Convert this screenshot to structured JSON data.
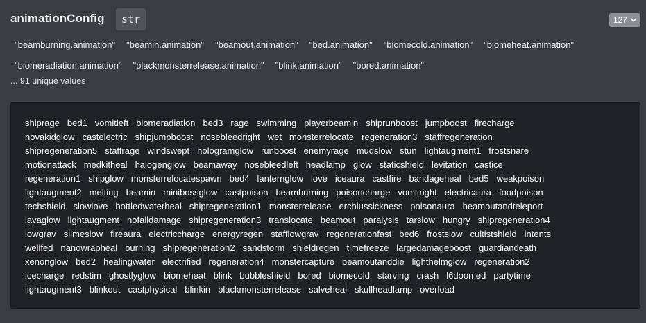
{
  "field": {
    "name": "animationConfig",
    "type": "str",
    "count_label": "127"
  },
  "preview_tags": [
    [
      "\"beamburning.animation\"",
      "\"beamin.animation\"",
      "\"beamout.animation\"",
      "\"bed.animation\"",
      "\"biomecold.animation\"",
      "\"biomeheat.animation\""
    ],
    [
      "\"biomeradiation.animation\"",
      "\"blackmonsterrelease.animation\"",
      "\"blink.animation\"",
      "\"bored.animation\""
    ]
  ],
  "unique_note": "... 91 unique values",
  "values": [
    [
      "shiprage",
      "bed1",
      "vomitleft",
      "biomeradiation",
      "bed3",
      "rage",
      "swimming",
      "playerbeamin",
      "shiprunboost",
      "jumpboost",
      "firecharge"
    ],
    [
      "novakidglow",
      "castelectric",
      "shipjumpboost",
      "nosebleedright",
      "wet",
      "monsterrelocate",
      "regeneration3",
      "staffregeneration"
    ],
    [
      "shipregeneration5",
      "staffrage",
      "windswept",
      "hologramglow",
      "runboost",
      "enemyrage",
      "mudslow",
      "stun",
      "lightaugment1",
      "frostsnare"
    ],
    [
      "motionattack",
      "medkitheal",
      "halogenglow",
      "beamaway",
      "nosebleedleft",
      "headlamp",
      "glow",
      "staticshield",
      "levitation",
      "castice"
    ],
    [
      "regeneration1",
      "shipglow",
      "monsterrelocatespawn",
      "bed4",
      "lanternglow",
      "love",
      "iceaura",
      "castfire",
      "bandageheal",
      "bed5",
      "weakpoison"
    ],
    [
      "lightaugment2",
      "melting",
      "beamin",
      "minibossglow",
      "castpoison",
      "beamburning",
      "poisoncharge",
      "vomitright",
      "electricaura",
      "foodpoison"
    ],
    [
      "techshield",
      "slowlove",
      "bottledwaterheal",
      "shipregeneration1",
      "monsterrelease",
      "erchiussickness",
      "poisonaura",
      "beamoutandteleport"
    ],
    [
      "lavaglow",
      "lightaugment",
      "nofalldamage",
      "shipregeneration3",
      "translocate",
      "beamout",
      "paralysis",
      "tarslow",
      "hungry",
      "shipregeneration4"
    ],
    [
      "lowgrav",
      "slimeslow",
      "fireaura",
      "electriccharge",
      "energyregen",
      "stafflowgrav",
      "regenerationfast",
      "bed6",
      "frostslow",
      "cultistshield",
      "intents"
    ],
    [
      "wellfed",
      "nanowrapheal",
      "burning",
      "shipregeneration2",
      "sandstorm",
      "shieldregen",
      "timefreeze",
      "largedamageboost",
      "guardiandeath"
    ],
    [
      "xenonglow",
      "bed2",
      "healingwater",
      "electrified",
      "regeneration4",
      "monstercapture",
      "beamoutanddie",
      "lighthelmglow",
      "regeneration2"
    ],
    [
      "icecharge",
      "redstim",
      "ghostlyglow",
      "biomeheat",
      "blink",
      "bubbleshield",
      "bored",
      "biomecold",
      "starving",
      "crash",
      "l6doomed",
      "partytime"
    ],
    [
      "lightaugment3",
      "blinkout",
      "castphysical",
      "blinkin",
      "blackmonsterrelease",
      "salveheal",
      "skullheadlamp",
      "overload"
    ]
  ],
  "icons": {
    "count_dropdown": "chevron-down-icon"
  },
  "colors": {
    "background": "#393c41",
    "values_panel": "#202225",
    "badge": "#505359",
    "count_button": "#8c9096"
  }
}
